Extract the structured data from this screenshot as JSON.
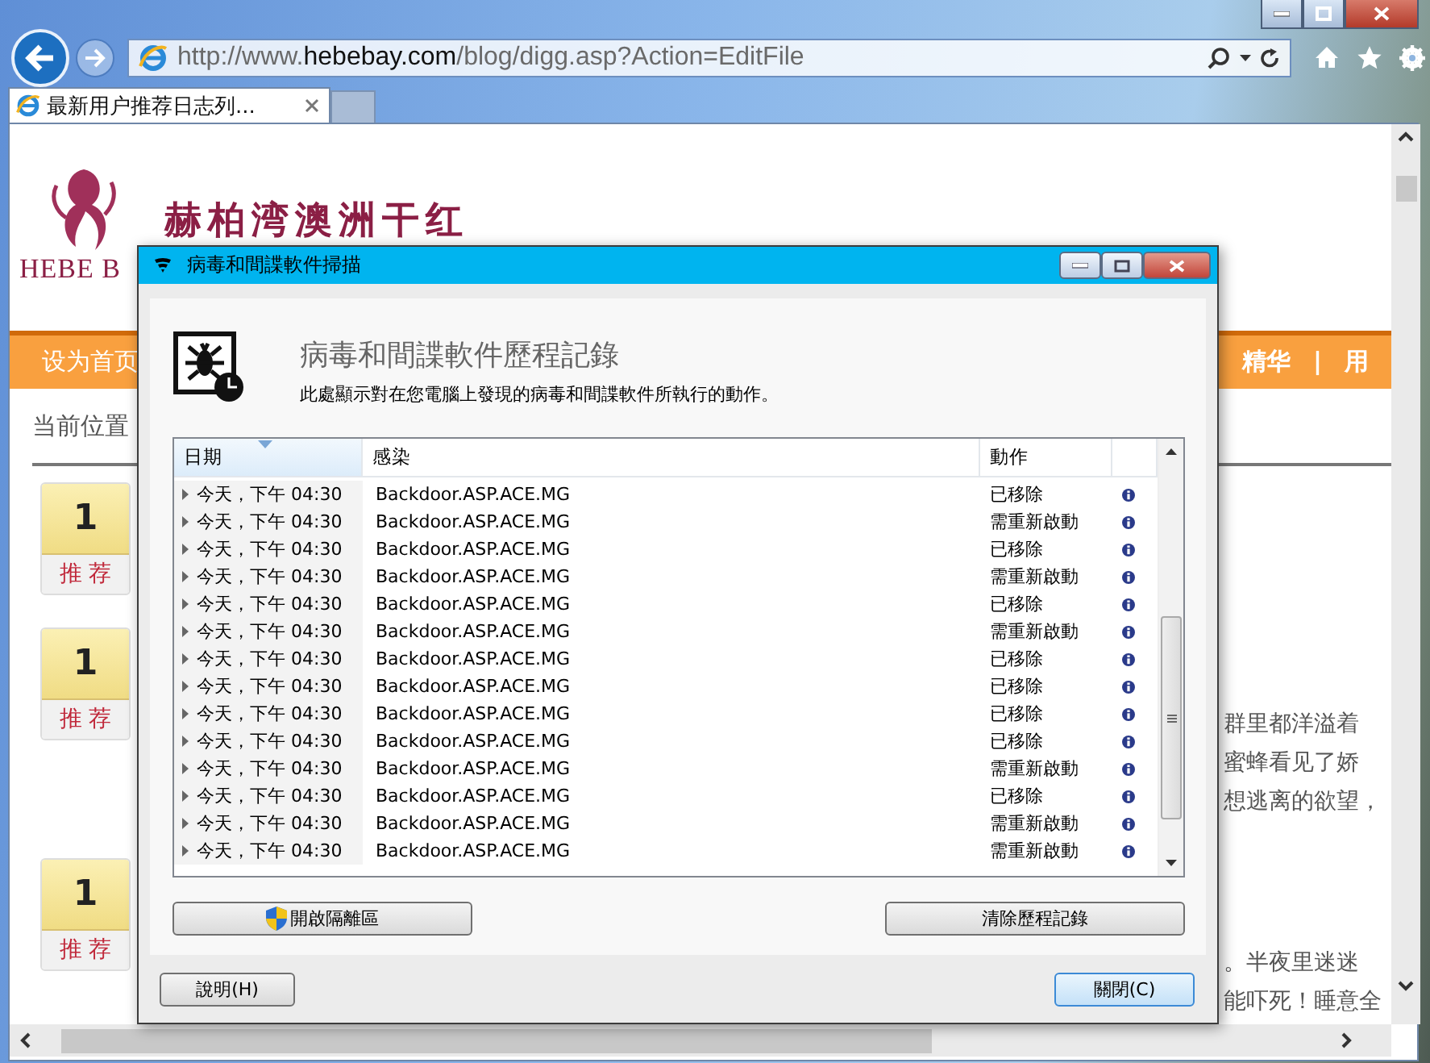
{
  "browser": {
    "url": "http://www.**hebebay.com**/blog/digg.asp?Action=EditFile",
    "tabs": [
      {
        "label": "最新用户推荐日志列...",
        "selected": true
      }
    ]
  },
  "page": {
    "brand": "HEBE B",
    "title": "赫柏湾澳洲干红",
    "nav_left": "设为首页",
    "nav_right": [
      "精华",
      "|",
      "用"
    ],
    "breadcrumb": "当前位置",
    "recommend": [
      {
        "count": "1",
        "label": "推 荐"
      },
      {
        "count": "1",
        "label": "推 荐"
      },
      {
        "count": "1",
        "label": "推 荐"
      }
    ],
    "text_upper": [
      "群里都洋溢着",
      "蜜蜂看见了娇",
      "想逃离的欲望，"
    ],
    "text_lower": [
      "。半夜里迷迷",
      "能吓死！睡意全"
    ]
  },
  "dialog": {
    "title": "病毒和間諜軟件掃描",
    "heading": "病毒和間諜軟件歷程記錄",
    "description": "此處顯示對在您電腦上發現的病毒和間諜軟件所執行的動作。",
    "columns": [
      {
        "label": "日期",
        "sorted": true
      },
      {
        "label": "感染",
        "sorted": false
      },
      {
        "label": "動作",
        "sorted": false
      }
    ],
    "rows": [
      {
        "date": "今天，下午 04:30",
        "infection": "Backdoor.ASP.ACE.MG",
        "action": "已移除"
      },
      {
        "date": "今天，下午 04:30",
        "infection": "Backdoor.ASP.ACE.MG",
        "action": "需重新啟動"
      },
      {
        "date": "今天，下午 04:30",
        "infection": "Backdoor.ASP.ACE.MG",
        "action": "已移除"
      },
      {
        "date": "今天，下午 04:30",
        "infection": "Backdoor.ASP.ACE.MG",
        "action": "需重新啟動"
      },
      {
        "date": "今天，下午 04:30",
        "infection": "Backdoor.ASP.ACE.MG",
        "action": "已移除"
      },
      {
        "date": "今天，下午 04:30",
        "infection": "Backdoor.ASP.ACE.MG",
        "action": "需重新啟動"
      },
      {
        "date": "今天，下午 04:30",
        "infection": "Backdoor.ASP.ACE.MG",
        "action": "已移除"
      },
      {
        "date": "今天，下午 04:30",
        "infection": "Backdoor.ASP.ACE.MG",
        "action": "已移除"
      },
      {
        "date": "今天，下午 04:30",
        "infection": "Backdoor.ASP.ACE.MG",
        "action": "已移除"
      },
      {
        "date": "今天，下午 04:30",
        "infection": "Backdoor.ASP.ACE.MG",
        "action": "已移除"
      },
      {
        "date": "今天，下午 04:30",
        "infection": "Backdoor.ASP.ACE.MG",
        "action": "需重新啟動"
      },
      {
        "date": "今天，下午 04:30",
        "infection": "Backdoor.ASP.ACE.MG",
        "action": "已移除"
      },
      {
        "date": "今天，下午 04:30",
        "infection": "Backdoor.ASP.ACE.MG",
        "action": "需重新啟動"
      },
      {
        "date": "今天，下午 04:30",
        "infection": "Backdoor.ASP.ACE.MG",
        "action": "需重新啟動"
      }
    ],
    "quarantine_button": "開啟隔離區",
    "clear_button": "清除歷程記錄",
    "footer_buttons": [
      {
        "label": "說明(H)",
        "default": false
      },
      {
        "label": "關閉(C)",
        "default": true
      }
    ]
  }
}
